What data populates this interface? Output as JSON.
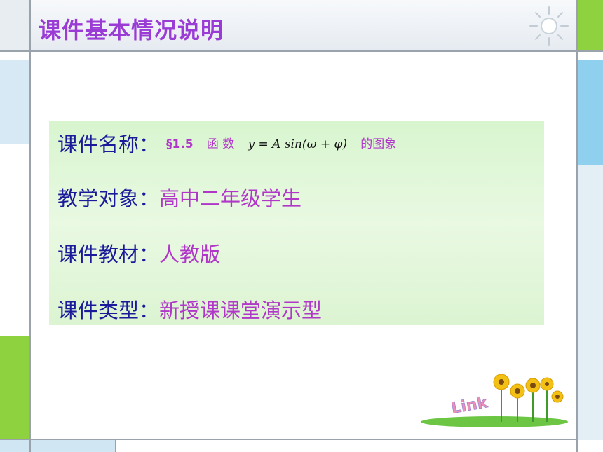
{
  "slide": {
    "title": "课件基本情况说明",
    "rows": [
      {
        "label": "课件名称：",
        "section": "§1.5",
        "fn_word": "函 数",
        "formula": "y = A sin(ω + φ)",
        "suffix": "的图象"
      },
      {
        "label": "教学对象：",
        "value": "高中二年级学生"
      },
      {
        "label": "课件教材：",
        "value": "人教版"
      },
      {
        "label": "课件类型：",
        "value": "新授课课堂演示型"
      }
    ]
  },
  "decoration": {
    "sun": "sun-icon",
    "flowers": "sunflowers-logo",
    "logo_text": "Link"
  },
  "colors": {
    "title": "#9b3bd6",
    "label": "#1a1a9a",
    "value": "#b137c9",
    "panel": "#dcf4d2",
    "frame_line": "#9aa3ab",
    "left_blue": "#bfe0f2",
    "left_green": "#8fd23f",
    "right_blue": "#8fd0ee",
    "right_green": "#8fd23f"
  }
}
